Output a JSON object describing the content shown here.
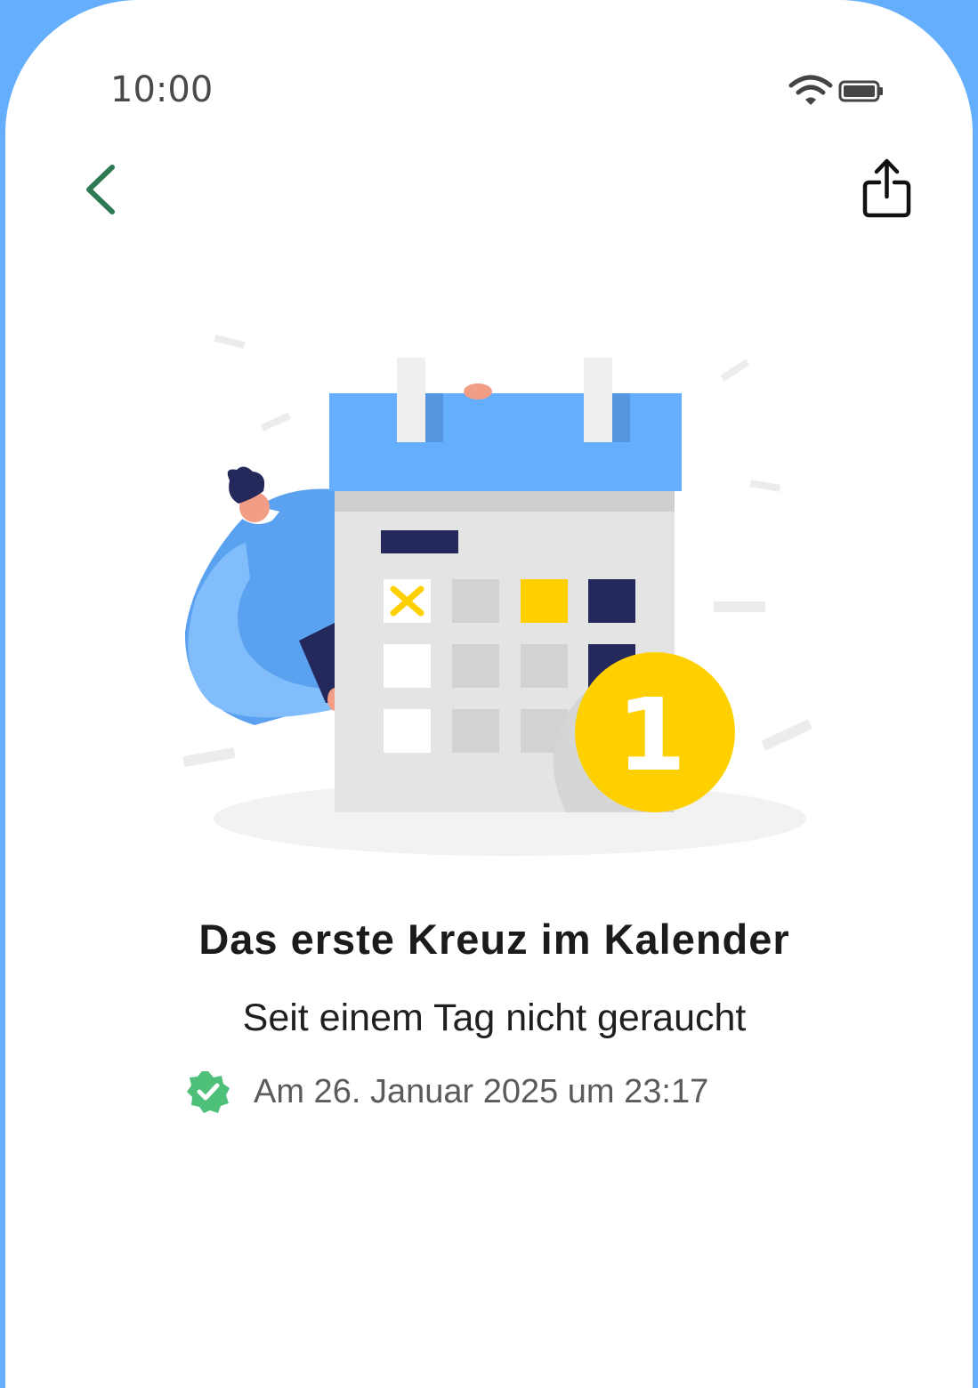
{
  "status_bar": {
    "time": "10:00"
  },
  "colors": {
    "accent_green": "#2d7a52",
    "calendar_blue": "#64aefb",
    "coin_yellow": "#ffd000",
    "navy": "#25285a",
    "badge_green": "#4fc07a"
  },
  "icons": {
    "wifi": "wifi-icon",
    "battery": "battery-icon",
    "back": "chevron-left-icon",
    "share": "share-icon",
    "verified": "verified-badge-icon"
  },
  "illustration": {
    "coin_number": "1"
  },
  "achievement": {
    "title": "Das erste Kreuz im Kalender",
    "subtitle": "Seit einem Tag nicht geraucht",
    "date": "Am 26. Januar 2025 um 23:17"
  }
}
